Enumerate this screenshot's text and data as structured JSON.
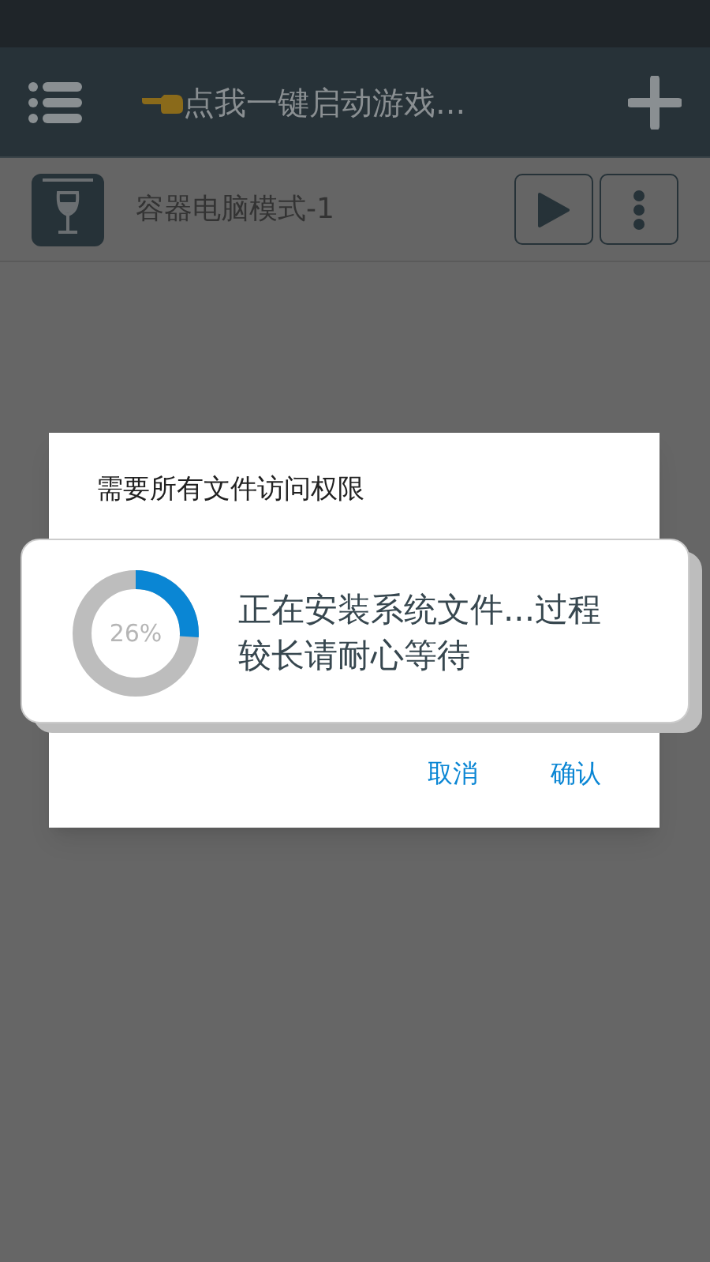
{
  "toolbar": {
    "title": "点我一键启动游戏..."
  },
  "container": {
    "name": "容器电脑模式-1"
  },
  "dialog": {
    "title": "需要所有文件访问权限",
    "buttons": [
      "取消",
      "确认"
    ]
  },
  "progress": {
    "level": 0.26,
    "reading": "26%",
    "message": "正在安装系统文件...过程较长请耐心等待"
  }
}
